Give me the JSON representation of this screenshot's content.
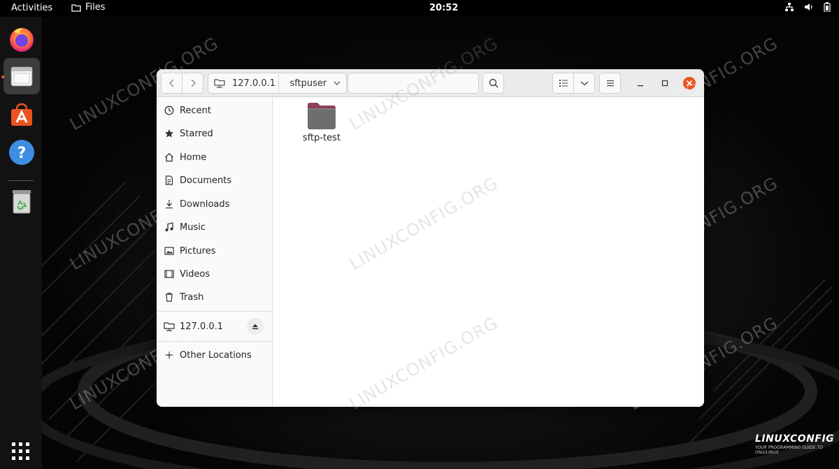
{
  "topbar": {
    "activities": "Activities",
    "app_name": "Files",
    "clock": "20:52",
    "tray_icons": [
      "network-icon",
      "volume-icon",
      "battery-icon"
    ]
  },
  "dock": {
    "items": [
      {
        "name": "Firefox",
        "icon": "firefox-icon"
      },
      {
        "name": "Files",
        "icon": "files-icon",
        "active": true
      },
      {
        "name": "Ubuntu Software",
        "icon": "software-icon"
      },
      {
        "name": "Help",
        "icon": "help-icon"
      },
      {
        "name": "Trash",
        "icon": "trash-icon"
      }
    ],
    "show_apps_icon": "grid-icon"
  },
  "window": {
    "pathbar": {
      "segments": [
        "127.0.0.1",
        "sftpuser"
      ]
    },
    "sidebar": {
      "places": [
        {
          "label": "Recent",
          "icon": "clock-icon"
        },
        {
          "label": "Starred",
          "icon": "star-icon"
        },
        {
          "label": "Home",
          "icon": "home-icon"
        },
        {
          "label": "Documents",
          "icon": "document-icon"
        },
        {
          "label": "Downloads",
          "icon": "download-icon"
        },
        {
          "label": "Music",
          "icon": "music-icon"
        },
        {
          "label": "Pictures",
          "icon": "picture-icon"
        },
        {
          "label": "Videos",
          "icon": "video-icon"
        },
        {
          "label": "Trash",
          "icon": "trash-icon"
        }
      ],
      "mounts": [
        {
          "label": "127.0.0.1",
          "icon": "network-drive-icon"
        }
      ],
      "other": {
        "label": "Other Locations",
        "icon": "plus-icon"
      }
    },
    "files": [
      {
        "name": "sftp-test",
        "type": "folder"
      }
    ]
  },
  "watermark": "LINUXCONFIG.ORG",
  "brand": {
    "logo": "LINUXCONFIG",
    "tagline": "YOUR PROGRAMMING GUIDE TO GNU/LINUX"
  },
  "colors": {
    "accent": "#e95420",
    "folder": "#6e6e6e",
    "folder_tab": "#8f3f5a"
  }
}
